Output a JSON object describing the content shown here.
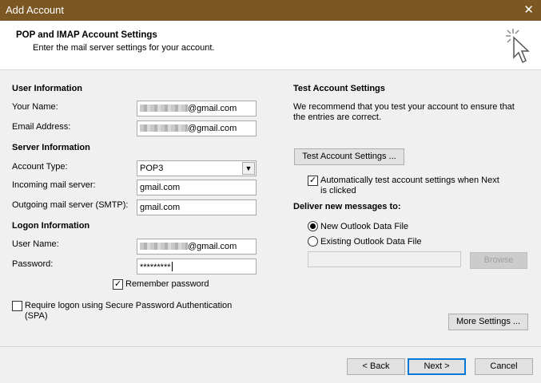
{
  "window": {
    "title": "Add Account",
    "close_glyph": "✕"
  },
  "header": {
    "title": "POP and IMAP Account Settings",
    "subtitle": "Enter the mail server settings for your account.",
    "icon": "cursor-click-icon"
  },
  "user_info": {
    "heading": "User Information",
    "name_label": "Your Name:",
    "name_value": "@gmail.com",
    "email_label": "Email Address:",
    "email_value": "@gmail.com"
  },
  "server_info": {
    "heading": "Server Information",
    "account_type_label": "Account Type:",
    "account_type_value": "POP3",
    "incoming_label": "Incoming mail server:",
    "incoming_value": "gmail.com",
    "outgoing_label": "Outgoing mail server (SMTP):",
    "outgoing_value": "gmail.com"
  },
  "logon_info": {
    "heading": "Logon Information",
    "username_label": "User Name:",
    "username_value": "@gmail.com",
    "password_label": "Password:",
    "password_value": "*********",
    "remember_label": "Remember password",
    "remember_checked": true,
    "spa_label": "Require logon using Secure Password Authentication",
    "spa_label_2": "(SPA)",
    "spa_checked": false
  },
  "test_settings": {
    "heading": "Test Account Settings",
    "description_1": "We recommend that you test your account to ensure that",
    "description_2": "the entries are correct.",
    "button_label": "Test Account Settings ...",
    "auto_test_label_1": "Automatically test account settings when Next",
    "auto_test_label_2": "is clicked",
    "auto_test_checked": true
  },
  "deliver": {
    "heading": "Deliver new messages to:",
    "option_new": "New Outlook Data File",
    "option_existing": "Existing Outlook Data File",
    "selected": "new",
    "browse_label": "Browse"
  },
  "buttons": {
    "more_settings": "More Settings ...",
    "back": "< Back",
    "next": "Next >",
    "cancel": "Cancel"
  },
  "colors": {
    "titlebar": "#7a5723",
    "accent": "#0078d7"
  }
}
